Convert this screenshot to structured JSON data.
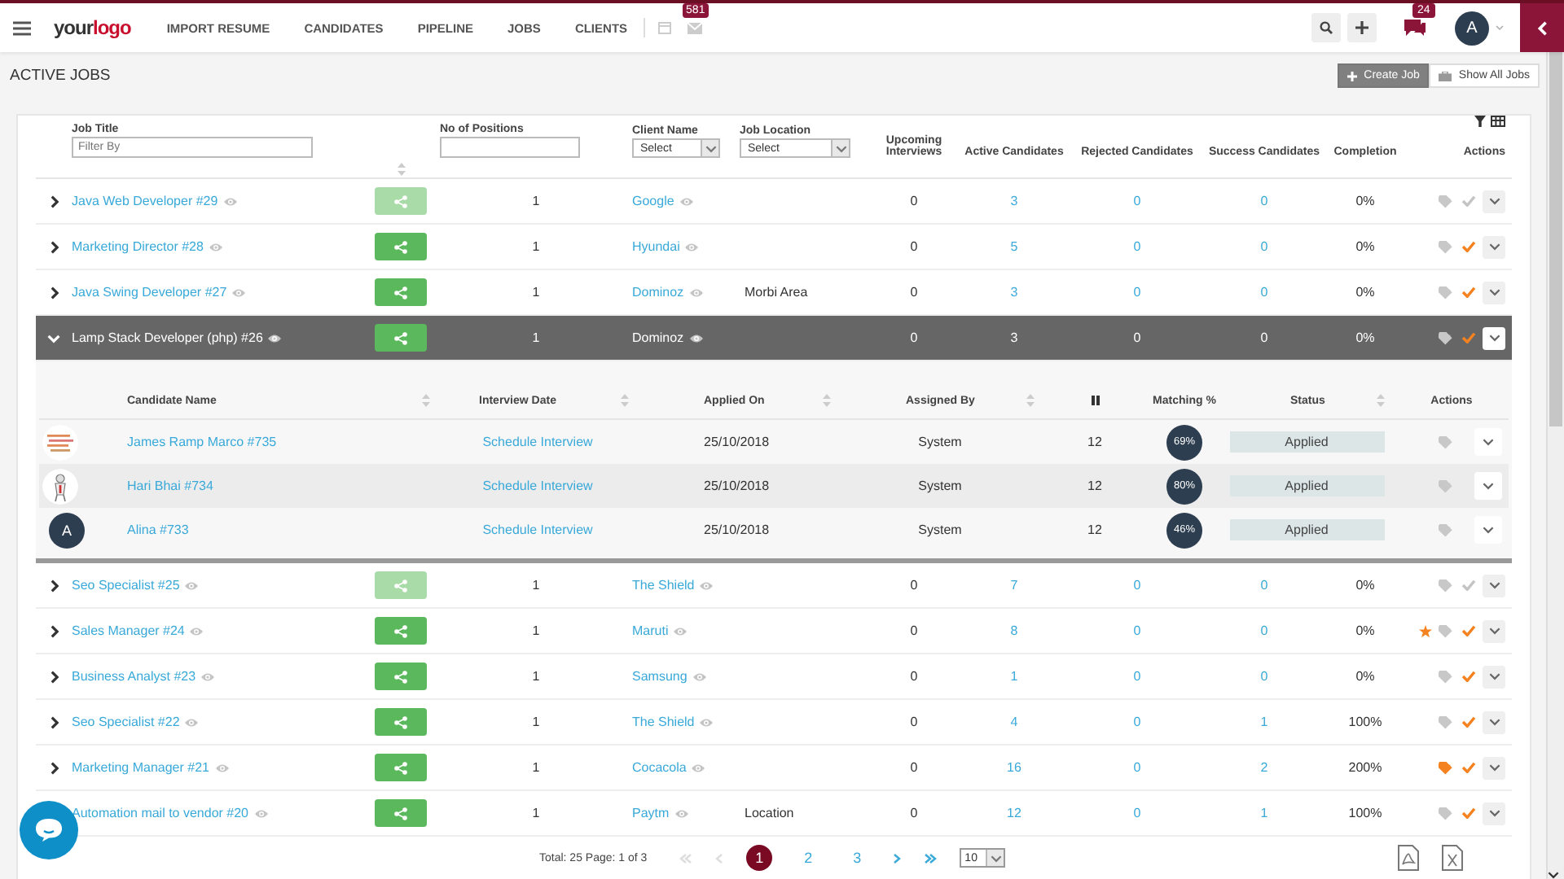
{
  "navbar": {
    "logo": {
      "first": "your",
      "second": "logo"
    },
    "menu": [
      "IMPORT RESUME",
      "CANDIDATES",
      "PIPELINE",
      "JOBS",
      "CLIENTS"
    ],
    "mail_badge": "581",
    "chat_badge": "24",
    "avatar": "A"
  },
  "page_title": "ACTIVE JOBS",
  "buttons": [
    {
      "label": "Create Job",
      "kind": "primary"
    },
    {
      "label": "Show All Jobs",
      "kind": "secondary"
    }
  ],
  "jobs_table": {
    "columns": [
      {
        "label": "Job Title",
        "filter": {
          "kind": "input",
          "placeholder": "Filter By"
        }
      },
      {
        "label": "No of Positions",
        "filter": {
          "kind": "input"
        }
      },
      {
        "label": "Client Name",
        "filter": {
          "kind": "select",
          "value": "Select"
        }
      },
      {
        "label": "Job Location",
        "filter": {
          "kind": "select",
          "value": "Select"
        }
      },
      {
        "label": "Upcoming Interviews"
      },
      {
        "label": "Active Candidates"
      },
      {
        "label": "Rejected Candidates"
      },
      {
        "label": "Success Candidates"
      },
      {
        "label": "Completion"
      },
      {
        "label": "Actions"
      }
    ],
    "rows": [
      {
        "title": "Java Web Developer #29",
        "share_disabled": true,
        "positions": "1",
        "client": "Google",
        "upcoming": "0",
        "active": "3",
        "rejected": "0",
        "success": "0",
        "completion": "0%",
        "starred": false,
        "tag_highlighted": false,
        "checked": false,
        "expanded": false
      },
      {
        "title": "Marketing Director #28",
        "share_disabled": false,
        "positions": "1",
        "client": "Hyundai",
        "upcoming": "0",
        "active": "5",
        "rejected": "0",
        "success": "0",
        "completion": "0%",
        "starred": false,
        "tag_highlighted": false,
        "checked": true,
        "expanded": false
      },
      {
        "title": "Java Swing Developer #27",
        "share_disabled": false,
        "positions": "1",
        "client": "Dominoz",
        "location": "Morbi Area",
        "upcoming": "0",
        "active": "3",
        "rejected": "0",
        "success": "0",
        "completion": "0%",
        "starred": false,
        "tag_highlighted": false,
        "checked": true,
        "expanded": false
      },
      {
        "title": "Lamp Stack Developer (php) #26",
        "share_disabled": false,
        "positions": "1",
        "client": "Dominoz",
        "upcoming": "0",
        "active": "3",
        "rejected": "0",
        "success": "0",
        "completion": "0%",
        "starred": false,
        "tag_highlighted": false,
        "checked": true,
        "expanded": true,
        "candidates": {
          "columns": [
            "Candidate Name",
            "Interview Date",
            "Applied On",
            "Assigned By",
            "Matching %",
            "Status",
            "Actions"
          ],
          "rows": [
            {
              "name": "James Ramp Marco #735",
              "interview": "Schedule Interview",
              "applied": "25/10/2018",
              "assigned": "System",
              "count": "12",
              "matching": "69%",
              "status": "Applied"
            },
            {
              "name": "Hari Bhai #734",
              "interview": "Schedule Interview",
              "applied": "25/10/2018",
              "assigned": "System",
              "count": "12",
              "matching": "80%",
              "status": "Applied"
            },
            {
              "avatar": {
                "kind": "letter",
                "letter": "A"
              },
              "name": "Alina #733",
              "interview": "Schedule Interview",
              "applied": "25/10/2018",
              "assigned": "System",
              "count": "12",
              "matching": "46%",
              "status": "Applied"
            }
          ]
        }
      },
      {
        "title": "Seo Specialist #25",
        "share_disabled": true,
        "positions": "1",
        "client": "The Shield",
        "upcoming": "0",
        "active": "7",
        "rejected": "0",
        "success": "0",
        "completion": "0%",
        "starred": false,
        "tag_highlighted": false,
        "checked": false,
        "expanded": false
      },
      {
        "title": "Sales Manager #24",
        "share_disabled": false,
        "positions": "1",
        "client": "Maruti",
        "upcoming": "0",
        "active": "8",
        "rejected": "0",
        "success": "0",
        "completion": "0%",
        "starred": true,
        "tag_highlighted": false,
        "checked": true,
        "expanded": false
      },
      {
        "title": "Business Analyst #23",
        "share_disabled": false,
        "positions": "1",
        "client": "Samsung",
        "upcoming": "0",
        "active": "1",
        "rejected": "0",
        "success": "0",
        "completion": "0%",
        "starred": false,
        "tag_highlighted": false,
        "checked": true,
        "expanded": false
      },
      {
        "title": "Seo Specialist #22",
        "share_disabled": false,
        "positions": "1",
        "client": "The Shield",
        "upcoming": "0",
        "active": "4",
        "rejected": "0",
        "success": "1",
        "completion": "100%",
        "starred": false,
        "tag_highlighted": false,
        "checked": true,
        "expanded": false
      },
      {
        "title": "Marketing Manager #21",
        "share_disabled": false,
        "positions": "1",
        "client": "Cocacola",
        "upcoming": "0",
        "active": "16",
        "rejected": "0",
        "success": "2",
        "completion": "200%",
        "starred": false,
        "tag_highlighted": true,
        "checked": true,
        "expanded": false
      },
      {
        "title": "Automation mail to vendor #20",
        "share_disabled": false,
        "positions": "1",
        "client": "Paytm",
        "location": "Location",
        "upcoming": "0",
        "active": "12",
        "rejected": "0",
        "success": "1",
        "completion": "100%",
        "starred": false,
        "tag_highlighted": false,
        "checked": true,
        "expanded": false
      }
    ]
  },
  "pagination": {
    "total": "Total: 25 Page: 1 of 3",
    "pages": [
      {
        "label": "1",
        "selected": true
      },
      {
        "label": "2",
        "selected": false
      },
      {
        "label": "3",
        "selected": false
      }
    ],
    "page_size": "10"
  }
}
